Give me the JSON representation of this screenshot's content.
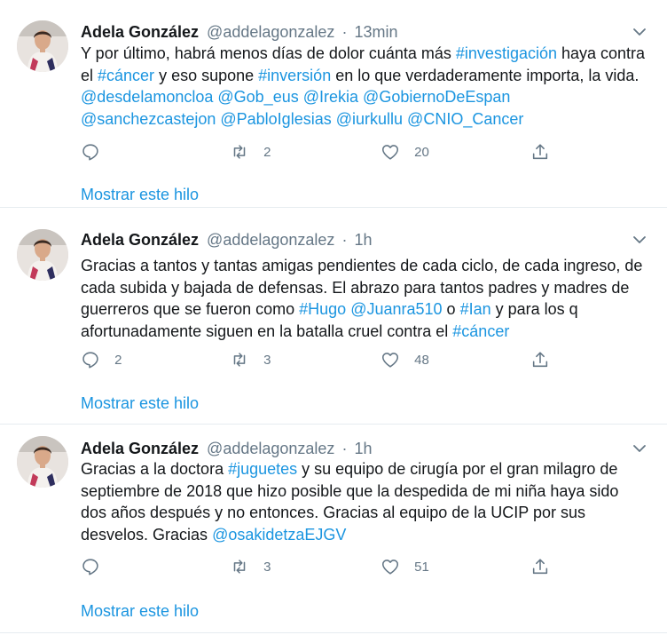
{
  "colors": {
    "link": "#1b95e0",
    "text": "#14171a",
    "secondary": "#657786",
    "divider": "#e6ecf0"
  },
  "tweets": [
    {
      "author_name": "Adela González",
      "author_handle": "@addelagonzalez",
      "separator": "·",
      "time": "13min",
      "segments": [
        {
          "t": "Y por último, habrá menos días de dolor cuánta más ",
          "link": false
        },
        {
          "t": "#investigación",
          "link": true
        },
        {
          "t": " haya contra el ",
          "link": false
        },
        {
          "t": "#cáncer",
          "link": true
        },
        {
          "t": " y eso supone ",
          "link": false
        },
        {
          "t": "#inversión",
          "link": true
        },
        {
          "t": " en lo que verdaderamente importa, la vida. ",
          "link": false
        },
        {
          "t": "@desdelamoncloa",
          "link": true
        },
        {
          "t": " ",
          "link": false
        },
        {
          "t": "@Gob_eus",
          "link": true
        },
        {
          "t": " ",
          "link": false
        },
        {
          "t": "@Irekia",
          "link": true
        },
        {
          "t": " ",
          "link": false
        },
        {
          "t": "@GobiernoDeEspan",
          "link": true
        },
        {
          "t": " ",
          "link": false
        },
        {
          "t": "@sanchezcastejon",
          "link": true
        },
        {
          "t": " ",
          "link": false
        },
        {
          "t": "@PabloIglesias",
          "link": true
        },
        {
          "t": " ",
          "link": false
        },
        {
          "t": "@iurkullu",
          "link": true
        },
        {
          "t": " ",
          "link": false
        },
        {
          "t": "@CNIO_Cancer",
          "link": true
        }
      ],
      "reply_count": "",
      "retweet_count": "2",
      "like_count": "20",
      "thread_link": "Mostrar este hilo",
      "icons": [
        "reply-icon",
        "retweet-icon",
        "like-icon",
        "share-icon",
        "chevron-down-icon"
      ]
    },
    {
      "author_name": "Adela González",
      "author_handle": "@addelagonzalez",
      "separator": "·",
      "time": "1h",
      "segments": [
        {
          "t": "Gracias a tantos y tantas amigas pendientes de cada ciclo, de cada ingreso, de cada subida y bajada de defensas. El abrazo para tantos padres y madres de guerreros que se fueron como ",
          "link": false
        },
        {
          "t": "#Hugo",
          "link": true
        },
        {
          "t": " ",
          "link": false
        },
        {
          "t": "@Juanra510",
          "link": true
        },
        {
          "t": " o ",
          "link": false
        },
        {
          "t": "#Ian",
          "link": true
        },
        {
          "t": " y para los q afortunadamente siguen en la batalla cruel contra el ",
          "link": false
        },
        {
          "t": "#cáncer",
          "link": true
        }
      ],
      "reply_count": "2",
      "retweet_count": "3",
      "like_count": "48",
      "thread_link": "Mostrar este hilo",
      "icons": [
        "reply-icon",
        "retweet-icon",
        "like-icon",
        "share-icon",
        "chevron-down-icon"
      ]
    },
    {
      "author_name": "Adela González",
      "author_handle": "@addelagonzalez",
      "separator": "·",
      "time": "1h",
      "segments": [
        {
          "t": "Gracias a la doctora ",
          "link": false
        },
        {
          "t": "#juguetes",
          "link": true
        },
        {
          "t": " y su equipo de cirugía por el gran milagro de septiembre de 2018 que hizo posible que la despedida de mi niña haya sido dos años después y no entonces. Gracias al equipo de la UCIP por sus desvelos. Gracias ",
          "link": false
        },
        {
          "t": "@osakidetzaEJGV",
          "link": true
        }
      ],
      "reply_count": "",
      "retweet_count": "3",
      "like_count": "51",
      "thread_link": "Mostrar este hilo",
      "icons": [
        "reply-icon",
        "retweet-icon",
        "like-icon",
        "share-icon",
        "chevron-down-icon"
      ]
    }
  ]
}
